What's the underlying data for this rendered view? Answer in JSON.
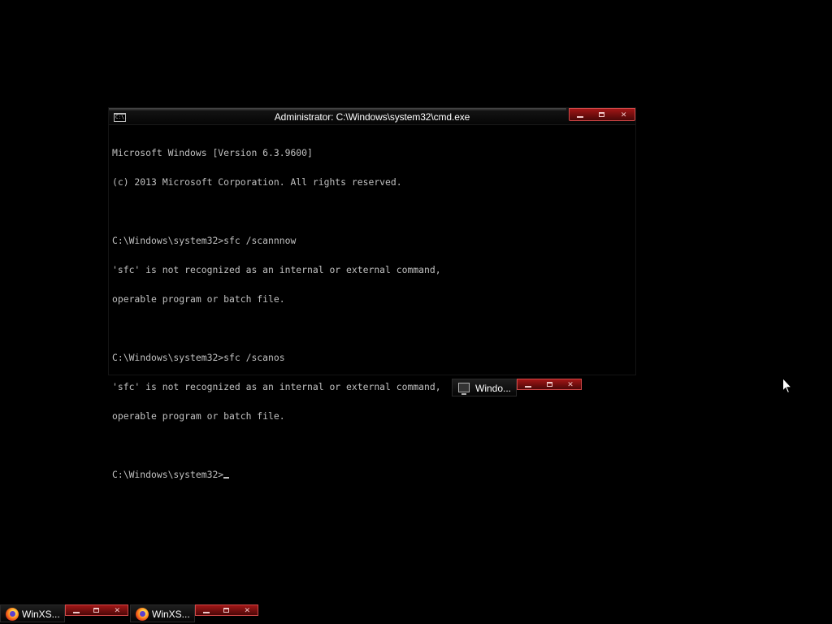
{
  "cmd_window": {
    "title": "Administrator: C:\\Windows\\system32\\cmd.exe",
    "icon_text": "C:\\.",
    "buttons": {
      "minimize": "minimize",
      "maximize": "maximize",
      "close": "✕"
    },
    "console_lines": [
      "Microsoft Windows [Version 6.3.9600]",
      "(c) 2013 Microsoft Corporation. All rights reserved.",
      "",
      "C:\\Windows\\system32>sfc /scannnow",
      "'sfc' is not recognized as an internal or external command,",
      "operable program or batch file.",
      "",
      "C:\\Windows\\system32>sfc /scanos",
      "'sfc' is not recognized as an internal or external command,",
      "operable program or batch file.",
      "",
      "C:\\Windows\\system32>"
    ]
  },
  "minimized_window": {
    "label": "Windo...",
    "icon": "computer-icon"
  },
  "taskbar": {
    "items": [
      {
        "label": "WinXS...",
        "icon": "firefox-icon"
      },
      {
        "label": "WinXS...",
        "icon": "firefox-icon"
      }
    ]
  },
  "colors": {
    "caption_red": "#a11616",
    "console_text": "#c0c0c0",
    "background": "#000000"
  }
}
